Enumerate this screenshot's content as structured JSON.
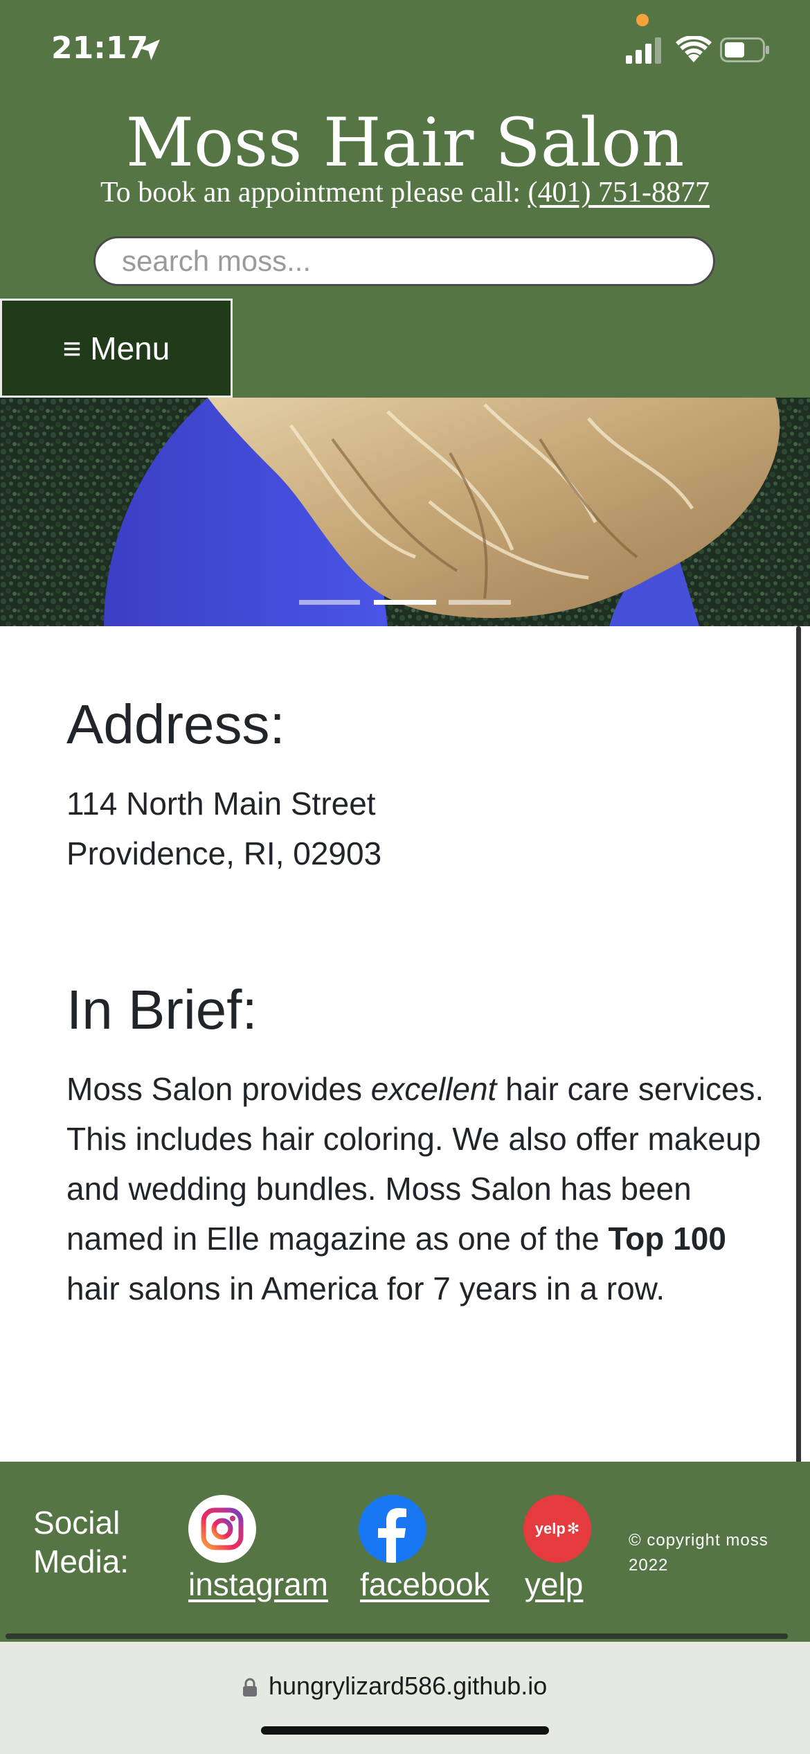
{
  "status_bar": {
    "time": "21:17"
  },
  "header": {
    "site_title": "Moss Hair Salon",
    "booking_text": "To book an appointment please call: ",
    "phone": "(401) 751-8877",
    "search_placeholder": "search moss...",
    "menu_label": "≡ Menu"
  },
  "carousel": {
    "slide_count": 3,
    "active_index": 1
  },
  "address": {
    "heading": "Address:",
    "line1": "114 North Main Street",
    "line2": "Providence, RI, 02903"
  },
  "brief": {
    "heading": "In Brief:",
    "text_part1": "Moss Salon provides ",
    "emphasis": "excellent",
    "text_part2": " hair care services. This includes hair coloring. We also offer makeup and wedding bundles. Moss Salon has been named in Elle magazine as one of the ",
    "strong": "Top 100",
    "text_part3": " hair salons in America for 7 years in a row."
  },
  "footer": {
    "social_label_line1": "Social",
    "social_label_line2": "Media:",
    "instagram": "instagram",
    "facebook": "facebook",
    "yelp": "yelp",
    "yelp_logo_text": "yelp",
    "copyright_line1": "© copyright moss",
    "copyright_line2": "2022"
  },
  "browser": {
    "url": "hungrylizard586.github.io"
  },
  "colors": {
    "header_green": "#557545",
    "menu_dark_green": "#203a1a",
    "text": "#212529",
    "facebook_blue": "#1877f2",
    "yelp_red": "#e53b3f"
  }
}
